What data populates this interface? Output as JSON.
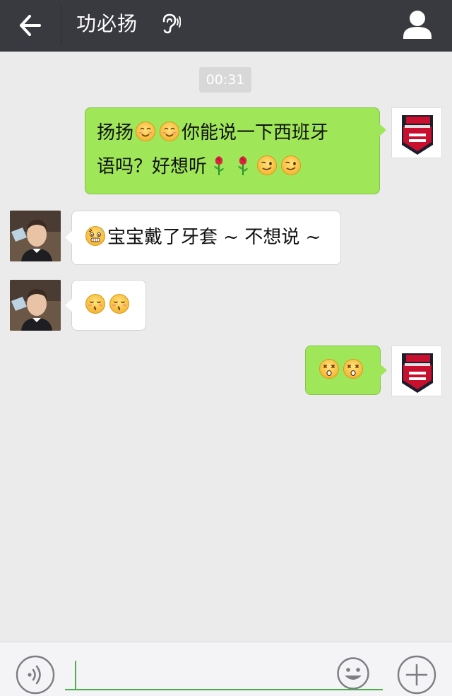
{
  "header": {
    "title": "功必扬",
    "back_icon": "back-arrow-icon",
    "ear_icon": "ear-mode-icon",
    "profile_icon": "person-icon",
    "background_color": "#393a3f"
  },
  "chat": {
    "timestamp": "00:31",
    "messages": [
      {
        "sender": "me",
        "line1_prefix": "扬扬",
        "line1_suffix": "你能说一下西班牙",
        "line2_prefix": "语吗？好想听",
        "emojis": [
          "smile-emoji",
          "smile-emoji",
          "rose-emoji",
          "rose-emoji",
          "wink-emoji",
          "wink-emoji"
        ]
      },
      {
        "sender": "other",
        "text": "宝宝戴了牙套 ~ 不想说 ~",
        "emojis": [
          "embarrassed-emoji"
        ]
      },
      {
        "sender": "other",
        "text": "",
        "emojis": [
          "kiss-emoji",
          "kiss-emoji"
        ]
      },
      {
        "sender": "me",
        "text": "",
        "emojis": [
          "dizzy-emoji",
          "dizzy-emoji"
        ]
      }
    ]
  },
  "input": {
    "value": "",
    "voice_icon": "voice-icon",
    "emoji_icon": "emoji-icon",
    "plus_icon": "plus-icon",
    "accent_color": "#47b34a"
  },
  "colors": {
    "my_bubble": "#9fe658",
    "other_bubble": "#ffffff",
    "chat_background": "#ebebeb"
  }
}
